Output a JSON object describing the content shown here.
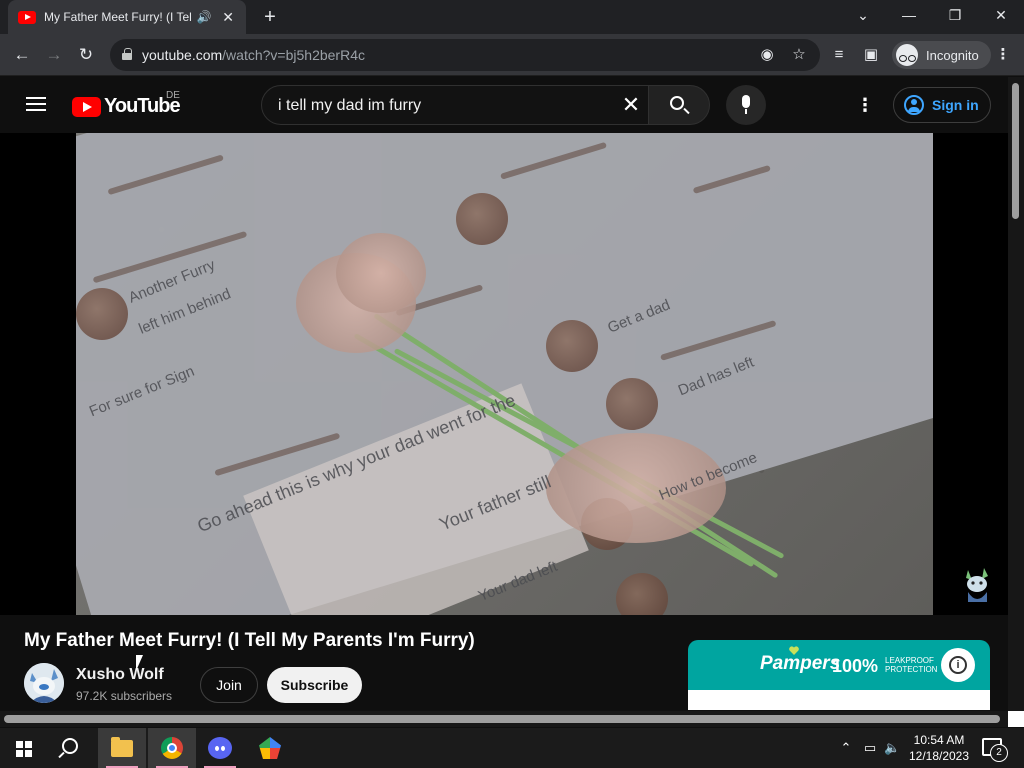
{
  "browser": {
    "tab_title": "My Father Meet Furry! (I Tell My Parents I'm Furry)",
    "url_host": "youtube.com",
    "url_path": "/watch?v=bj5h2berR4c",
    "profile_label": "Incognito",
    "window_controls": [
      "minimize",
      "restore",
      "close"
    ]
  },
  "youtube": {
    "logo_text": "YouTube",
    "region": "DE",
    "search_query": "i tell my dad im furry",
    "signin_label": "Sign in"
  },
  "video": {
    "overlay_texts": [
      "Another Furry",
      "left him behind",
      "For sure for Sign",
      "Get a dad",
      "Dad has left",
      "Go ahead this is why your dad went for the",
      "How to become",
      "Your father still",
      "Your dad left"
    ]
  },
  "watch": {
    "title": "My Father Meet Furry! (I Tell My Parents I'm Furry)",
    "channel_name": "Xusho Wolf",
    "subscribers": "97.2K subscribers",
    "join_label": "Join",
    "subscribe_label": "Subscribe"
  },
  "ad": {
    "brand": "Pampers",
    "headline": "100%",
    "claim": "LEAKPROOF PROTECTION",
    "colors": {
      "banner": "#00a5a0"
    }
  },
  "taskbar": {
    "apps": [
      "start-icon",
      "search-icon",
      "file-explorer-icon",
      "chrome-icon",
      "discord-icon",
      "gemini-icon"
    ],
    "time": "10:54 AM",
    "date": "12/18/2023",
    "notification_count": "2"
  }
}
